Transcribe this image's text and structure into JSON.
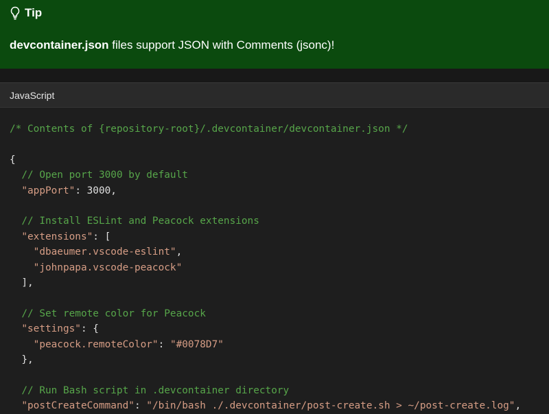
{
  "tip": {
    "title": "Tip",
    "filename": "devcontainer.json",
    "message": " files support JSON with Comments (jsonc)!"
  },
  "code": {
    "language": "JavaScript",
    "lines": [
      {
        "type": "comment",
        "text": "/* Contents of {repository-root}/.devcontainer/devcontainer.json */"
      },
      {
        "type": "blank",
        "text": ""
      },
      {
        "type": "punct",
        "text": "{"
      },
      {
        "type": "comment",
        "indent": "  ",
        "text": "// Open port 3000 by default"
      },
      {
        "type": "kv",
        "indent": "  ",
        "key": "\"appPort\"",
        "sep": ": ",
        "value": "3000",
        "tail": ","
      },
      {
        "type": "blank",
        "text": ""
      },
      {
        "type": "comment",
        "indent": "  ",
        "text": "// Install ESLint and Peacock extensions"
      },
      {
        "type": "kv",
        "indent": "  ",
        "key": "\"extensions\"",
        "sep": ": [",
        "value": "",
        "tail": ""
      },
      {
        "type": "str",
        "indent": "    ",
        "text": "\"dbaeumer.vscode-eslint\"",
        "tail": ","
      },
      {
        "type": "str",
        "indent": "    ",
        "text": "\"johnpapa.vscode-peacock\"",
        "tail": ""
      },
      {
        "type": "punct",
        "indent": "  ",
        "text": "],"
      },
      {
        "type": "blank",
        "text": ""
      },
      {
        "type": "comment",
        "indent": "  ",
        "text": "// Set remote color for Peacock"
      },
      {
        "type": "kv",
        "indent": "  ",
        "key": "\"settings\"",
        "sep": ": {",
        "value": "",
        "tail": ""
      },
      {
        "type": "kv",
        "indent": "    ",
        "key": "\"peacock.remoteColor\"",
        "sep": ": ",
        "value": "\"#0078D7\"",
        "tail": ""
      },
      {
        "type": "punct",
        "indent": "  ",
        "text": "},"
      },
      {
        "type": "blank",
        "text": ""
      },
      {
        "type": "comment",
        "indent": "  ",
        "text": "// Run Bash script in .devcontainer directory"
      },
      {
        "type": "kv",
        "indent": "  ",
        "key": "\"postCreateCommand\"",
        "sep": ": ",
        "value": "\"/bin/bash ./.devcontainer/post-create.sh > ~/post-create.log\"",
        "tail": ","
      }
    ]
  },
  "colors": {
    "tip_background": "#0b4a0e",
    "code_background": "#1e1e1e",
    "comment": "#57a64a",
    "string": "#d69d85",
    "number": "#b5cea8"
  }
}
